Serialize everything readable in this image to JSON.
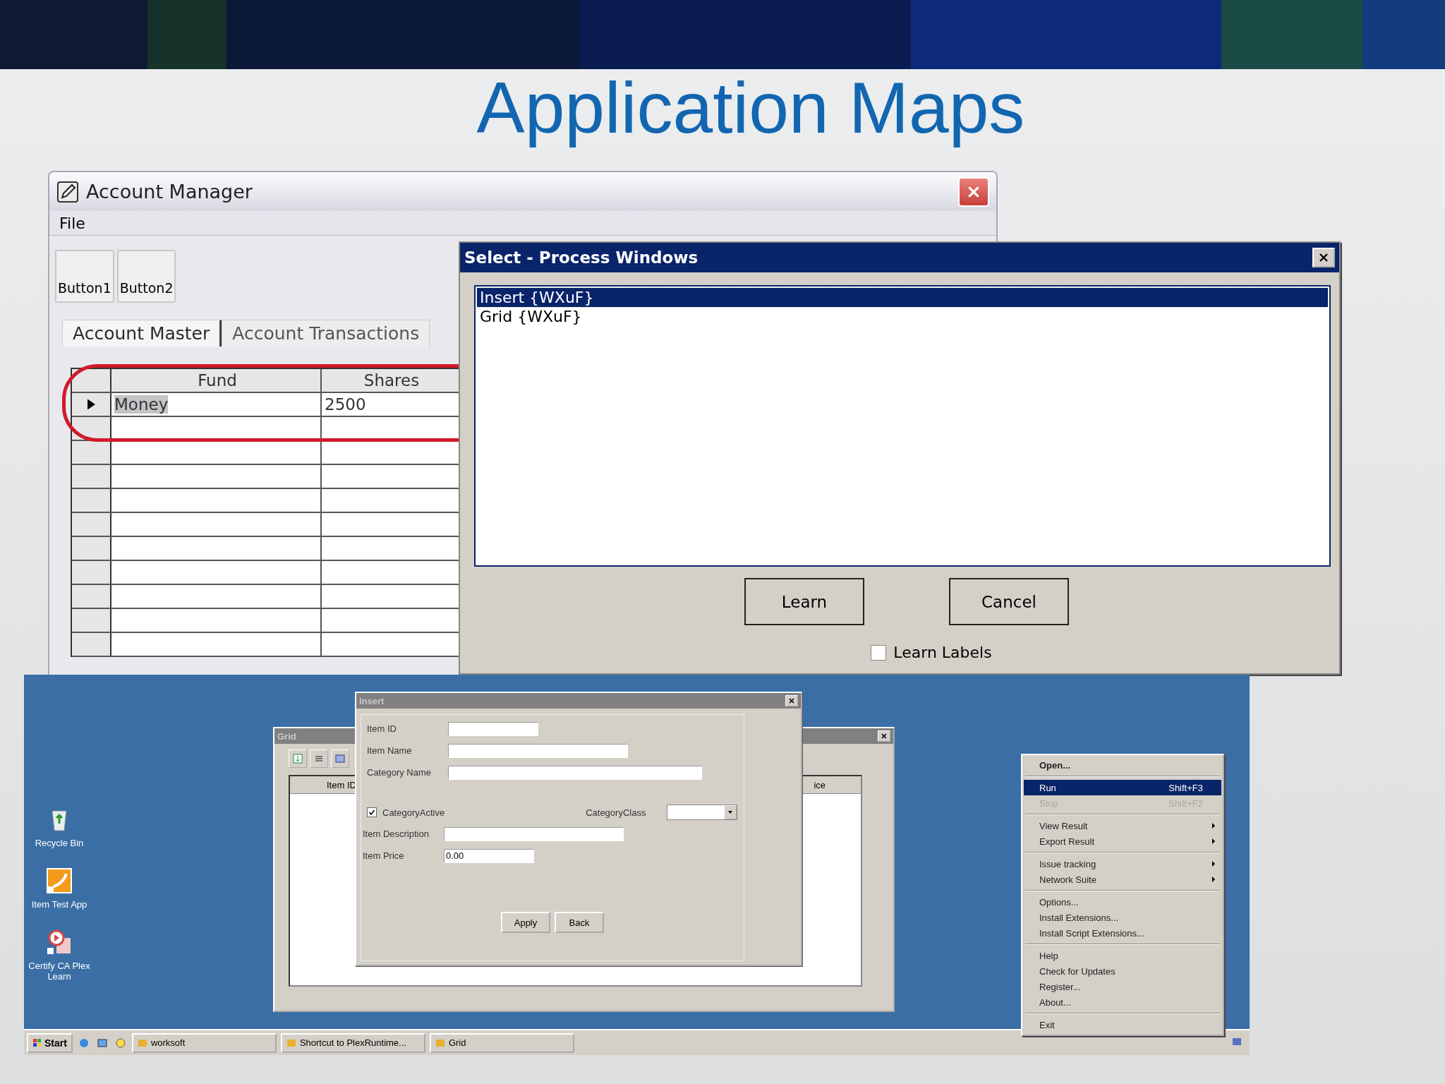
{
  "slide": {
    "title": "Application Maps"
  },
  "account_manager": {
    "title": "Account Manager",
    "menu": [
      "File"
    ],
    "buttons": [
      "Button1",
      "Button2"
    ],
    "tabs": [
      {
        "label": "Account Master",
        "selected": true
      },
      {
        "label": "Account Transactions",
        "selected": false
      }
    ],
    "grid": {
      "columns": [
        "Fund",
        "Shares"
      ],
      "rows": [
        {
          "cells": [
            "Money",
            "2500"
          ],
          "selected": true
        }
      ]
    }
  },
  "select_dialog": {
    "title": "Select - Process Windows",
    "items": [
      {
        "label": "Insert  {WXuF}",
        "selected": true
      },
      {
        "label": "Grid  {WXuF}",
        "selected": false
      }
    ],
    "buttons": [
      "Learn",
      "Cancel"
    ],
    "checkbox": {
      "label": "Learn Labels",
      "checked": false
    }
  },
  "desktop": {
    "icons": [
      {
        "label": "Recycle Bin",
        "kind": "bin"
      },
      {
        "label": "Item Test App",
        "kind": "app"
      },
      {
        "label": "Certify CA Plex Learn",
        "kind": "certify"
      }
    ],
    "grid_window": {
      "title": "Grid",
      "columns": [
        "Item ID",
        "ice"
      ]
    },
    "insert_dialog": {
      "title": "Insert",
      "fields": [
        {
          "label": "Item ID",
          "kind": "short"
        },
        {
          "label": "Item Name",
          "kind": "medium"
        },
        {
          "label": "Category Name",
          "kind": "long"
        }
      ],
      "checkbox": {
        "label": "CategoryActive",
        "checked": true
      },
      "dropdown": {
        "label": "CategoryClass"
      },
      "fields_2": [
        {
          "label": "Item Description",
          "kind": "medium"
        },
        {
          "label": "Item Price",
          "kind": "short",
          "value": "0.00"
        }
      ],
      "buttons": [
        "Apply",
        "Back"
      ]
    },
    "context_menu": [
      {
        "kind": "item",
        "label": "Open...",
        "default": true,
        "selected": false,
        "disabled": false,
        "submenu": false
      },
      {
        "kind": "separator"
      },
      {
        "kind": "item",
        "label": "Run",
        "shortcut": "Shift+F3",
        "default": false,
        "selected": true,
        "disabled": false,
        "submenu": false
      },
      {
        "kind": "item",
        "label": "Stop",
        "shortcut": "Shift+F2",
        "default": false,
        "selected": false,
        "disabled": true,
        "submenu": false
      },
      {
        "kind": "separator"
      },
      {
        "kind": "item",
        "label": "View Result",
        "default": false,
        "selected": false,
        "disabled": false,
        "submenu": true
      },
      {
        "kind": "item",
        "label": "Export Result",
        "default": false,
        "selected": false,
        "disabled": false,
        "submenu": true
      },
      {
        "kind": "separator"
      },
      {
        "kind": "item",
        "label": "Issue tracking",
        "default": false,
        "selected": false,
        "disabled": false,
        "submenu": true
      },
      {
        "kind": "item",
        "label": "Network Suite",
        "default": false,
        "selected": false,
        "disabled": false,
        "submenu": true
      },
      {
        "kind": "separator"
      },
      {
        "kind": "item",
        "label": "Options...",
        "default": false,
        "selected": false,
        "disabled": false,
        "submenu": false
      },
      {
        "kind": "item",
        "label": "Install Extensions...",
        "default": false,
        "selected": false,
        "disabled": false,
        "submenu": false
      },
      {
        "kind": "item",
        "label": "Install Script Extensions...",
        "default": false,
        "selected": false,
        "disabled": false,
        "submenu": false
      },
      {
        "kind": "separator"
      },
      {
        "kind": "item",
        "label": "Help",
        "default": false,
        "selected": false,
        "disabled": false,
        "submenu": false
      },
      {
        "kind": "item",
        "label": "Check for Updates",
        "default": false,
        "selected": false,
        "disabled": false,
        "submenu": false
      },
      {
        "kind": "item",
        "label": "Register...",
        "default": false,
        "selected": false,
        "disabled": false,
        "submenu": false
      },
      {
        "kind": "item",
        "label": "About...",
        "default": false,
        "selected": false,
        "disabled": false,
        "submenu": false
      },
      {
        "kind": "separator"
      },
      {
        "kind": "item",
        "label": "Exit",
        "default": false,
        "selected": false,
        "disabled": false,
        "submenu": false
      }
    ],
    "taskbar": {
      "start": "Start",
      "tasks": [
        "worksoft",
        "Shortcut to PlexRuntime...",
        "Grid"
      ]
    }
  }
}
